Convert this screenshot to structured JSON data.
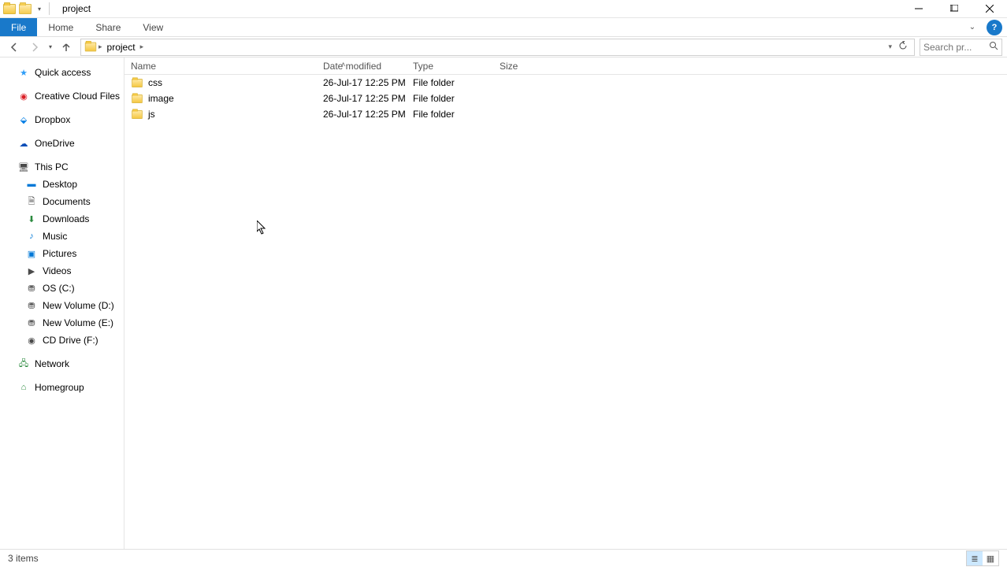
{
  "window": {
    "title": "project"
  },
  "ribbon": {
    "file": "File",
    "tabs": [
      "Home",
      "Share",
      "View"
    ]
  },
  "address": {
    "crumbs": [
      "project"
    ],
    "search_placeholder": "Search pr..."
  },
  "columns": {
    "name": "Name",
    "date": "Date modified",
    "type": "Type",
    "size": "Size"
  },
  "rows": [
    {
      "name": "css",
      "date": "26-Jul-17 12:25 PM",
      "type": "File folder",
      "size": ""
    },
    {
      "name": "image",
      "date": "26-Jul-17 12:25 PM",
      "type": "File folder",
      "size": ""
    },
    {
      "name": "js",
      "date": "26-Jul-17 12:25 PM",
      "type": "File folder",
      "size": ""
    }
  ],
  "sidebar": {
    "quick_access": "Quick access",
    "creative_cloud": "Creative Cloud Files",
    "dropbox": "Dropbox",
    "onedrive": "OneDrive",
    "this_pc": "This PC",
    "desktop": "Desktop",
    "documents": "Documents",
    "downloads": "Downloads",
    "music": "Music",
    "pictures": "Pictures",
    "videos": "Videos",
    "os_c": "OS (C:)",
    "vol_d": "New Volume (D:)",
    "vol_e": "New Volume (E:)",
    "cd_f": "CD Drive (F:)",
    "network": "Network",
    "homegroup": "Homegroup"
  },
  "status": {
    "text": "3 items"
  }
}
